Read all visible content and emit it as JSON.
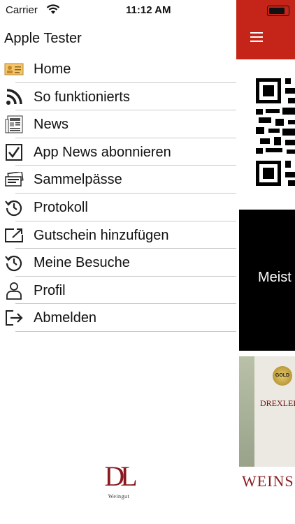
{
  "status": {
    "carrier": "Carrier",
    "time": "11:12 AM"
  },
  "menu": {
    "user_name": "Apple Tester",
    "items": [
      {
        "label": "Home",
        "icon": "id-card-icon"
      },
      {
        "label": "So funktionierts",
        "icon": "rss-icon"
      },
      {
        "label": "News",
        "icon": "newspaper-icon"
      },
      {
        "label": "App News abonnieren",
        "icon": "checkbox-icon"
      },
      {
        "label": "Sammelpässe",
        "icon": "tickets-icon"
      },
      {
        "label": "Protokoll",
        "icon": "history-icon"
      },
      {
        "label": "Gutschein hinzufügen",
        "icon": "voucher-add-icon"
      },
      {
        "label": "Meine Besuche",
        "icon": "history-icon"
      },
      {
        "label": "Profil",
        "icon": "person-icon"
      },
      {
        "label": "Abmelden",
        "icon": "logout-icon"
      }
    ]
  },
  "logo": {
    "monogram": "DL",
    "subtitle": "Weingut"
  },
  "background": {
    "accent": "#c52419",
    "banner_text": "Meist",
    "photo_badge": "GOLD",
    "photo_brand": "DREXLER-L",
    "photo_footer": "WEINS"
  }
}
